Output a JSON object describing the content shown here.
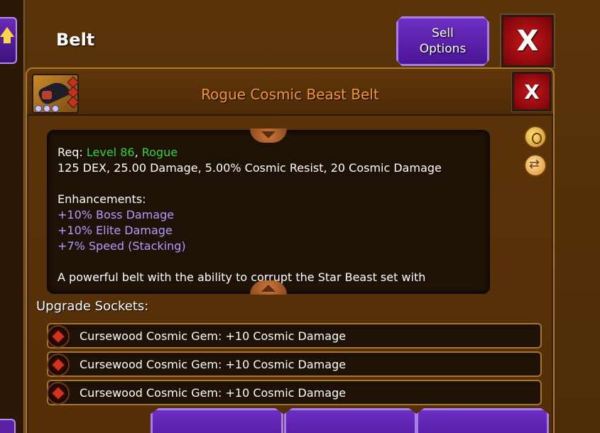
{
  "header": {
    "title": "Belt",
    "sell_label": "Sell\nOptions",
    "close_label": "X"
  },
  "item": {
    "title": "Rogue Cosmic Beast Belt",
    "close_label": "X",
    "req_prefix": "Req: ",
    "req_level": "Level 86",
    "req_sep": ", ",
    "req_class": "Rogue",
    "stats": "125 DEX, 25.00 Damage, 5.00% Cosmic Resist, 20 Cosmic Damage",
    "enhancements_label": "Enhancements:",
    "enhancements": [
      "+10% Boss Damage",
      "+10% Elite Damage",
      "+7% Speed (Stacking)"
    ],
    "description": "A powerful belt with the ability to corrupt the Star Beast set with"
  },
  "sockets": {
    "label": "Upgrade Sockets:",
    "items": [
      "Cursewood Cosmic Gem: +10 Cosmic Damage",
      "Cursewood Cosmic Gem: +10 Cosmic Damage",
      "Cursewood Cosmic Gem: +10 Cosmic Damage"
    ]
  },
  "icons": {
    "up": "up-arrow-icon",
    "bag": "gold-bag-icon",
    "swap": "swap-icon",
    "gem": "cosmic-gem-icon"
  },
  "colors": {
    "req_green": "#34d33a",
    "enhancement_purple": "#b49cff",
    "item_title_orange": "#f3973a",
    "button_purple": "#6d2fc4",
    "close_red": "#c8161c"
  }
}
